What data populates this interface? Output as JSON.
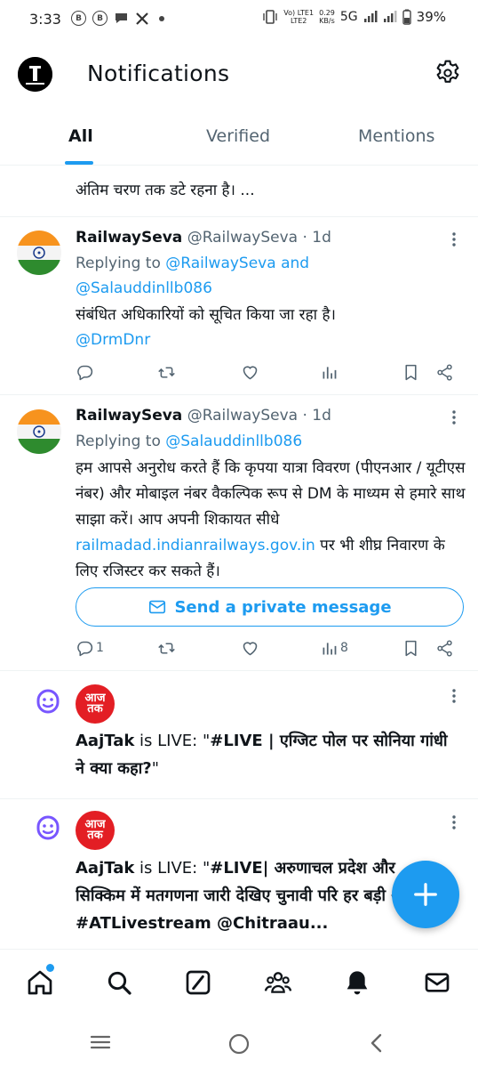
{
  "status_bar": {
    "time": "3:33",
    "notif_icons": [
      "B",
      "B"
    ],
    "network_label_top": "Vo) LTE1",
    "network_label_bottom": "LTE2",
    "speed_value": "0.29",
    "speed_unit": "KB/s",
    "network_type": "5G",
    "battery": "39%"
  },
  "header": {
    "title": "Notifications"
  },
  "tabs": [
    {
      "label": "All",
      "active": true
    },
    {
      "label": "Verified",
      "active": false
    },
    {
      "label": "Mentions",
      "active": false
    }
  ],
  "cut_post": {
    "text": "अंतिम चरण तक डटे रहना है। ..."
  },
  "posts": [
    {
      "name": "RailwaySeva",
      "handle": "@RailwaySeva · 1d",
      "replying_prefix": "Replying to ",
      "replying_users": "@RailwaySeva and",
      "replying_users_line2": "@Salauddinllb086",
      "body_line1": "संबंधित अधिकारियों को सूचित किया जा रहा है।",
      "body_mention": "@DrmDnr",
      "views": ""
    },
    {
      "name": "RailwaySeva",
      "handle": "@RailwaySeva · 1d",
      "replying_prefix": "Replying to ",
      "replying_users": "@Salauddinllb086",
      "body_part1": "हम आपसे अनुरोध करते हैं कि कृपया यात्रा विवरण (पीएनआर / यूटीएस नंबर) और मोबाइल नंबर वैकल्पिक रूप से DM के माध्यम से हमारे साथ साझा करें। आप अपनी शिकायत सीधे ",
      "body_link": "railmadad.indianrailways.gov.in",
      "body_part2": " पर भी शीघ्र निवारण के लिए रजिस्टर कर सकते हैं।",
      "dm_button": "Send a private message",
      "reply_count": "1",
      "views": "8"
    }
  ],
  "live_items": [
    {
      "logo_text": "आज तक",
      "author": "AajTak",
      "live_prefix": " is LIVE: \"",
      "live_title": "#LIVE | एग्जिट पोल पर सोनिया गांधी ने क्या कहा?",
      "live_suffix": "\""
    },
    {
      "logo_text": "आज तक",
      "author": "AajTak",
      "live_prefix": " is LIVE: \"",
      "live_title": "#LIVE| अरुणाचल प्रदेश और सिक्किम में मतगणना जारी  देखिए चुनावी परि हर बड़ी अपडेट  #ATLivestream @Chitraau..."
    }
  ],
  "colors": {
    "accent": "#1d9bf0",
    "secondary_text": "#536471",
    "aajtak_red": "#e31e24",
    "spaces_purple": "#7856ff"
  }
}
